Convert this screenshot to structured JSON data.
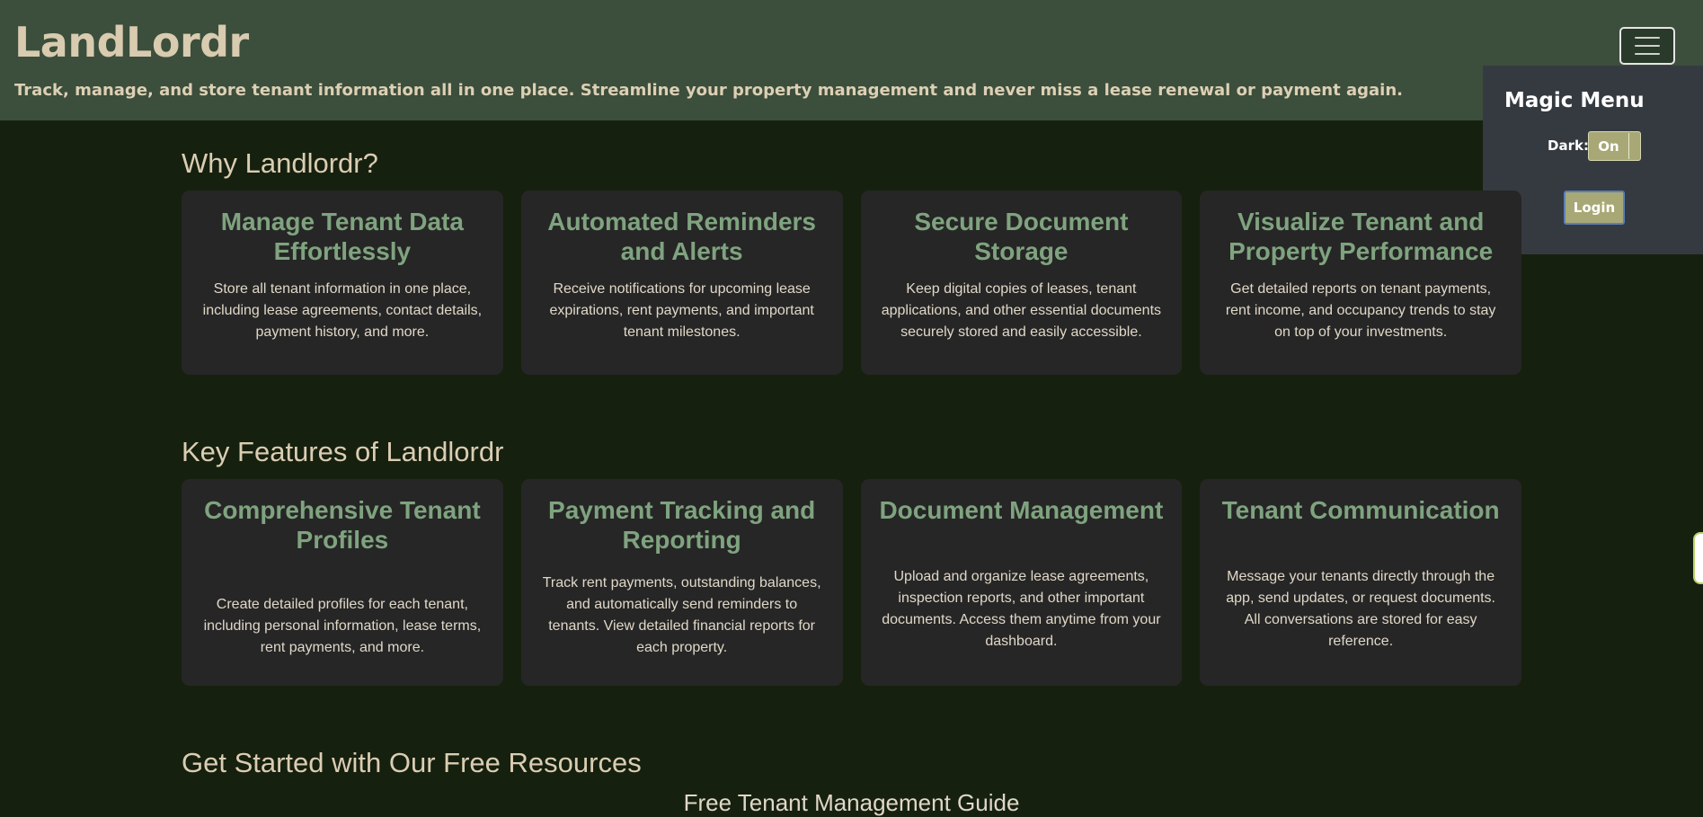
{
  "header": {
    "brand": "LandLordr",
    "tagline": "Track, manage, and store tenant information all in one place. Streamline your property management and never miss a lease renewal or payment again.",
    "menu_icon": "hamburger-icon"
  },
  "magic_menu": {
    "title": "Magic Menu",
    "dark_label": "Dark:",
    "dark_toggle_value": "On",
    "login_label": "Login"
  },
  "why": {
    "title": "Why Landlordr?",
    "cards": [
      {
        "title": "Manage Tenant Data Effortlessly",
        "text": "Store all tenant information in one place, including lease agreements, contact details, payment history, and more."
      },
      {
        "title": "Automated Reminders and Alerts",
        "text": "Receive notifications for upcoming lease expirations, rent payments, and important tenant milestones."
      },
      {
        "title": "Secure Document Storage",
        "text": "Keep digital copies of leases, tenant applications, and other essential documents securely stored and easily accessible."
      },
      {
        "title": "Visualize Tenant and Property Performance",
        "text": "Get detailed reports on tenant payments, rent income, and occupancy trends to stay on top of your investments."
      }
    ]
  },
  "features": {
    "title": "Key Features of Landlordr",
    "cards": [
      {
        "title": "Comprehensive Tenant Profiles",
        "text": "Create detailed profiles for each tenant, including personal information, lease terms, rent payments, and more."
      },
      {
        "title": "Payment Tracking and Reporting",
        "text": "Track rent payments, outstanding balances, and automatically send reminders to tenants. View detailed financial reports for each property."
      },
      {
        "title": "Document Management",
        "text": "Upload and organize lease agreements, inspection reports, and other important documents. Access them anytime from your dashboard."
      },
      {
        "title": "Tenant Communication",
        "text": "Message your tenants directly through the app, send updates, or request documents. All conversations are stored for easy reference."
      }
    ]
  },
  "resources": {
    "title": "Get Started with Our Free Resources",
    "first_item": "Free Tenant Management Guide"
  },
  "colors": {
    "background": "#16200f",
    "header": "#3c4e3c",
    "card": "#262626",
    "card_title": "#7fa37f",
    "accent_button": "#a8a876"
  }
}
